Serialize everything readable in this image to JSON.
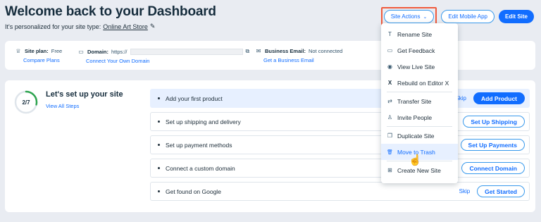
{
  "header": {
    "title": "Welcome back to your Dashboard",
    "subtitle": "It's personalized for your site type:",
    "site_type": "Online Art Store"
  },
  "top_actions": {
    "site_actions": "Site Actions",
    "edit_mobile": "Edit Mobile App",
    "edit_site": "Edit Site"
  },
  "info": {
    "plan_label": "Site plan:",
    "plan_value": "Free",
    "plan_link": "Compare Plans",
    "domain_label": "Domain:",
    "domain_value": "https://",
    "domain_link": "Connect Your Own Domain",
    "email_label": "Business Email:",
    "email_value": "Not connected",
    "email_link": "Get a Business Email"
  },
  "setup": {
    "progress": "2/7",
    "progress_fraction": 0.2857,
    "title": "Let's set up your site",
    "view_all": "View All Steps",
    "steps": [
      {
        "label": "Add your first product",
        "skip": "Skip",
        "button": "Add Product"
      },
      {
        "label": "Set up shipping and delivery",
        "skip": "",
        "button": "Set Up Shipping"
      },
      {
        "label": "Set up payment methods",
        "skip": "",
        "button": "Set Up Payments"
      },
      {
        "label": "Connect a custom domain",
        "skip": "",
        "button": "Connect Domain"
      },
      {
        "label": "Get found on Google",
        "skip": "Skip",
        "button": "Get Started"
      }
    ]
  },
  "menu": {
    "items": [
      {
        "label": "Rename Site",
        "icon": "T"
      },
      {
        "label": "Get Feedback",
        "icon": "▭"
      },
      {
        "label": "View Live Site",
        "icon": "◉"
      },
      {
        "label": "Rebuild on Editor X",
        "icon": "X"
      },
      {
        "label": "Transfer Site",
        "icon": "⇄"
      },
      {
        "label": "Invite People",
        "icon": "♙"
      },
      {
        "label": "Duplicate Site",
        "icon": "❐"
      },
      {
        "label": "Move to Trash",
        "icon": "🗑"
      },
      {
        "label": "Create New Site",
        "icon": "⊞"
      }
    ]
  },
  "colors": {
    "accent": "#116dff",
    "highlight_border": "#f05a3c",
    "progress": "#2ea44f"
  }
}
